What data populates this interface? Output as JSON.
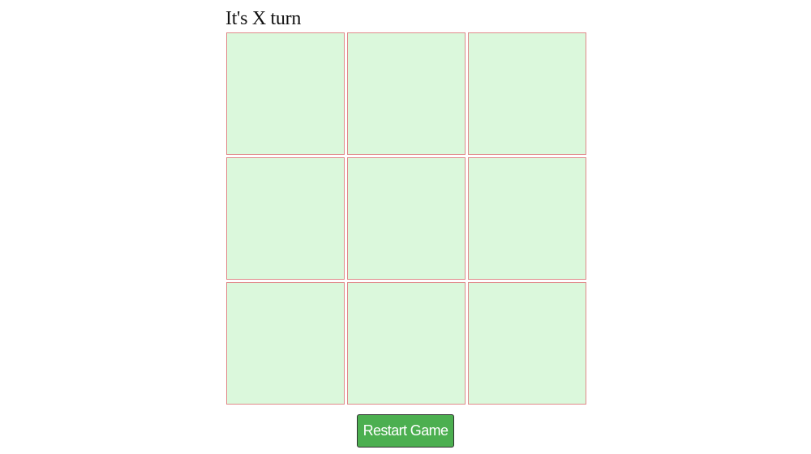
{
  "status_text": "It's X turn",
  "board": {
    "cells": [
      "",
      "",
      "",
      "",
      "",
      "",
      "",
      "",
      ""
    ]
  },
  "restart_label": "Restart Game",
  "colors": {
    "cell_background": "#dbf8dc",
    "cell_border": "#e08a8a",
    "button_background": "#4caf50"
  }
}
